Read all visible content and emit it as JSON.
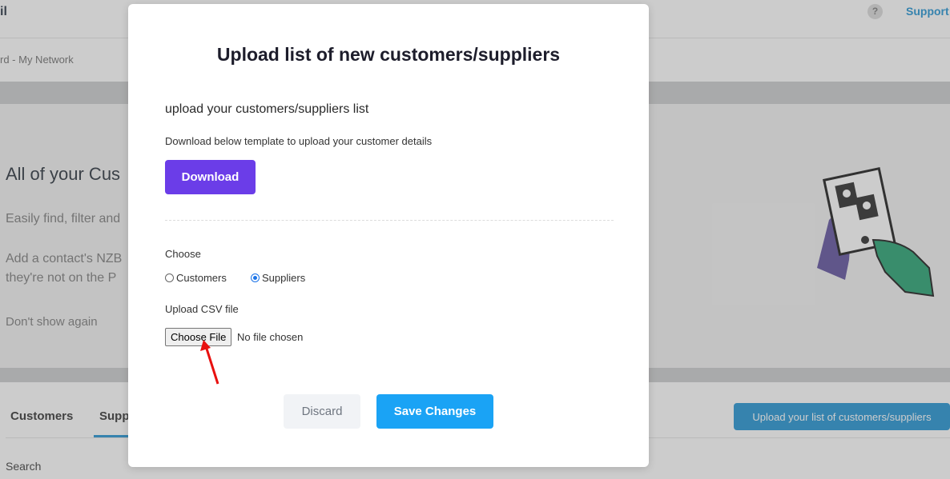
{
  "header": {
    "brand": "il",
    "help_icon": "?",
    "support_label": "Support"
  },
  "breadcrumb": "rd - My Network",
  "banner": {
    "title": "All of your Cus",
    "line1": "Easily find, filter and",
    "line2": "Add a contact's NZB",
    "line3": "they're not on the P",
    "dont_show": "Don't show again"
  },
  "tabs": {
    "customers": "Customers",
    "suppliers": "Supp"
  },
  "search_label": "Search",
  "upload_list_button": "Upload your list of customers/suppliers",
  "modal": {
    "title": "Upload list of new customers/suppliers",
    "subtitle": "upload your customers/suppliers list",
    "description": "Download below template to upload your customer details",
    "download_label": "Download",
    "choose_label": "Choose",
    "options": [
      {
        "label": "Customers",
        "checked": false
      },
      {
        "label": "Suppliers",
        "checked": true
      }
    ],
    "csv_label": "Upload CSV file",
    "choose_file_label": "Choose File",
    "file_status": "No file chosen",
    "discard_label": "Discard",
    "save_label": "Save Changes"
  },
  "colors": {
    "primary_blue": "#1a8fd1",
    "download_purple": "#6b3de8",
    "save_blue": "#1aa3f5",
    "annotation_red": "#e8100f"
  }
}
